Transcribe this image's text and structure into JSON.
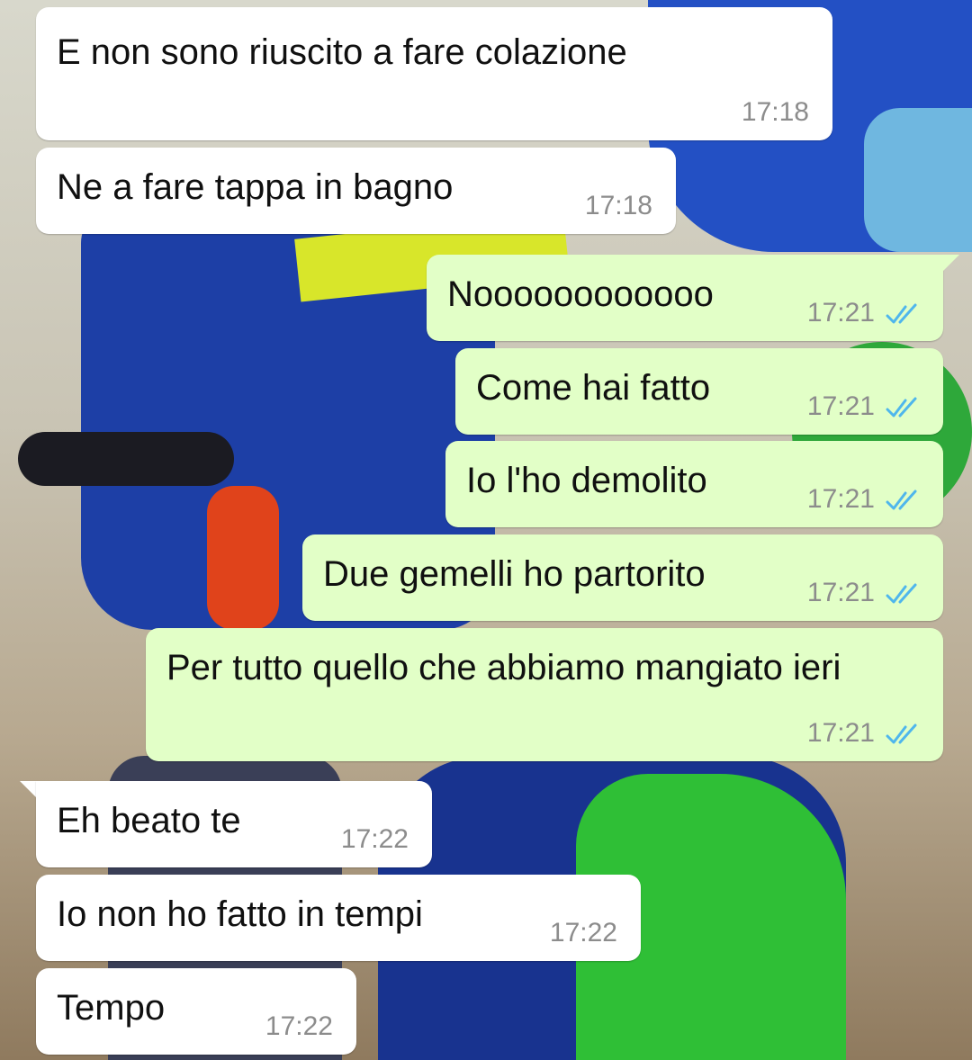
{
  "chat": {
    "messages": [
      {
        "direction": "in",
        "text": "E non sono riuscito a fare colazione",
        "time": "17:18"
      },
      {
        "direction": "in",
        "text": "Ne a fare tappa in bagno",
        "time": "17:18"
      },
      {
        "direction": "out",
        "text": "Noooooooooooo",
        "time": "17:21",
        "status": "read"
      },
      {
        "direction": "out",
        "text": "Come hai fatto",
        "time": "17:21",
        "status": "read"
      },
      {
        "direction": "out",
        "text": "Io l'ho demolito",
        "time": "17:21",
        "status": "read"
      },
      {
        "direction": "out",
        "text": "Due gemelli ho partorito",
        "time": "17:21",
        "status": "read"
      },
      {
        "direction": "out",
        "text": "Per tutto quello che abbiamo mangiato ieri",
        "time": "17:21",
        "status": "read"
      },
      {
        "direction": "in",
        "text": "Eh beato te",
        "time": "17:22"
      },
      {
        "direction": "in",
        "text": "Io non ho fatto in tempi",
        "time": "17:22"
      },
      {
        "direction": "in",
        "text": "Tempo",
        "time": "17:22"
      }
    ]
  },
  "colors": {
    "incoming_bubble": "#ffffff",
    "outgoing_bubble": "#e2ffc7",
    "read_ticks": "#4fb6ec",
    "timestamp": "#8c8c8c"
  },
  "icons": {
    "read_status": "double-check-icon"
  },
  "background": {
    "type": "wallpaper-photo"
  }
}
